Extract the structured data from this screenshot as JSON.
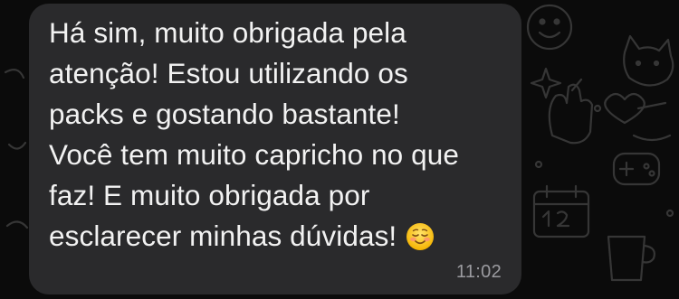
{
  "message": {
    "text": "Há sim, muito obrigada pela\natenção! Estou utilizando os\npacks e gostando bastante!\nVocê tem muito capricho no que\nfaz! E muito obrigada por\nesclarecer minhas dúvidas!",
    "emoji": "smiling-face-icon",
    "time": "11:02"
  },
  "colors": {
    "background": "#0b0b0b",
    "bubble": "#2a2a2c",
    "text": "#f2f2f2",
    "timestamp": "#9b9ba0",
    "doodle": "#333333"
  }
}
